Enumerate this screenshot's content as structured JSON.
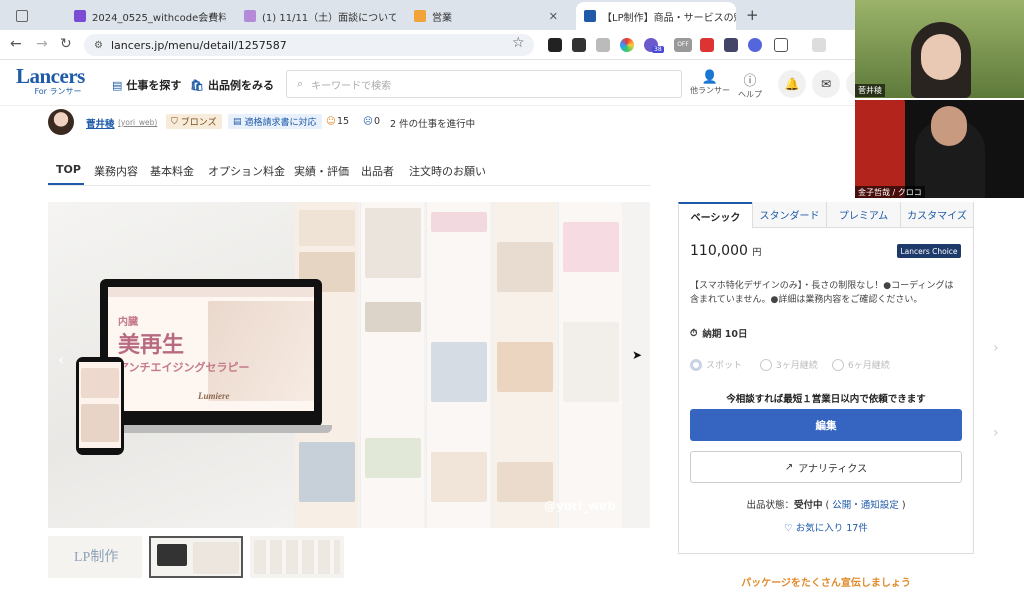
{
  "browser": {
    "tabs": [
      {
        "label": ""
      },
      {
        "label": "2024_0525_withcode会費料"
      },
      {
        "label": "(1) 11/11（土）面談について"
      },
      {
        "label": "営業"
      },
      {
        "label": "【LP制作】商品・サービスの魅力"
      }
    ],
    "new_tab": "+",
    "url": "lancers.jp/menu/detail/1257587",
    "ext_badges": {
      "badge38": "38",
      "off": "OFF"
    }
  },
  "site": {
    "logo_main": "Lancers",
    "logo_sub": "For ランサー",
    "nav_find_work": "仕事を探す",
    "nav_portfolio": "出品例をみる",
    "search_placeholder": "キーワードで検索",
    "other_lancers": "他ランサー",
    "help": "ヘルプ"
  },
  "seller": {
    "name": "菅井稜",
    "handle": "(yori_web)",
    "rank": "ブロンズ",
    "invoice": "適格請求書に対応",
    "good": "15",
    "bad": "0",
    "in_progress": "2 件の仕事を進行中"
  },
  "page_tabs": [
    "TOP",
    "業務内容",
    "基本料金",
    "オプション料金",
    "実績・評価",
    "出品者",
    "注文時のお願い"
  ],
  "gallery": {
    "lp_label_small": "内臓",
    "lp_title": "美再生",
    "lp_sub": "アンチエイジングセラピー",
    "lp_brand": "Lumiere",
    "watermark": "@yori_web",
    "thumb1_label": "LP制作"
  },
  "plan": {
    "types": [
      "ベーシック",
      "スタンダード",
      "プレミアム",
      "カスタマイズ"
    ],
    "price": "110,000",
    "currency": "円",
    "lancers_choice": "Lancers Choice",
    "description": "【スマホ特化デザインのみ】・長さの制限なし！●コーディングは含まれていません。●詳細は業務内容をご確認ください。",
    "delivery": "納期 10日",
    "options": [
      "スポット",
      "3ヶ月継続",
      "6ヶ月継続"
    ],
    "notice": "今相談すれば最短１営業日以内で依頼できます",
    "edit_label": "編集",
    "analytics_label": "アナリティクス",
    "status_label": "出品状態：",
    "status_value": "受付中",
    "status_public": "公開",
    "status_notify": "通知設定",
    "favorite": "お気に入り 17件",
    "promo": "パッケージをたくさん宣伝しましょう"
  },
  "video": {
    "person1": "菅井稜",
    "person2": "金子哲哉 / クロコ"
  }
}
